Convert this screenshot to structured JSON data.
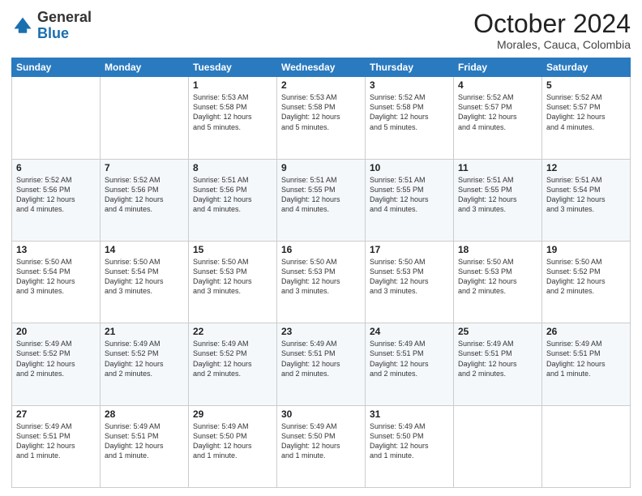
{
  "header": {
    "logo_general": "General",
    "logo_blue": "Blue",
    "month": "October 2024",
    "location": "Morales, Cauca, Colombia"
  },
  "days_of_week": [
    "Sunday",
    "Monday",
    "Tuesday",
    "Wednesday",
    "Thursday",
    "Friday",
    "Saturday"
  ],
  "weeks": [
    [
      {
        "day": "",
        "info": ""
      },
      {
        "day": "",
        "info": ""
      },
      {
        "day": "1",
        "info": "Sunrise: 5:53 AM\nSunset: 5:58 PM\nDaylight: 12 hours\nand 5 minutes."
      },
      {
        "day": "2",
        "info": "Sunrise: 5:53 AM\nSunset: 5:58 PM\nDaylight: 12 hours\nand 5 minutes."
      },
      {
        "day": "3",
        "info": "Sunrise: 5:52 AM\nSunset: 5:58 PM\nDaylight: 12 hours\nand 5 minutes."
      },
      {
        "day": "4",
        "info": "Sunrise: 5:52 AM\nSunset: 5:57 PM\nDaylight: 12 hours\nand 4 minutes."
      },
      {
        "day": "5",
        "info": "Sunrise: 5:52 AM\nSunset: 5:57 PM\nDaylight: 12 hours\nand 4 minutes."
      }
    ],
    [
      {
        "day": "6",
        "info": "Sunrise: 5:52 AM\nSunset: 5:56 PM\nDaylight: 12 hours\nand 4 minutes."
      },
      {
        "day": "7",
        "info": "Sunrise: 5:52 AM\nSunset: 5:56 PM\nDaylight: 12 hours\nand 4 minutes."
      },
      {
        "day": "8",
        "info": "Sunrise: 5:51 AM\nSunset: 5:56 PM\nDaylight: 12 hours\nand 4 minutes."
      },
      {
        "day": "9",
        "info": "Sunrise: 5:51 AM\nSunset: 5:55 PM\nDaylight: 12 hours\nand 4 minutes."
      },
      {
        "day": "10",
        "info": "Sunrise: 5:51 AM\nSunset: 5:55 PM\nDaylight: 12 hours\nand 4 minutes."
      },
      {
        "day": "11",
        "info": "Sunrise: 5:51 AM\nSunset: 5:55 PM\nDaylight: 12 hours\nand 3 minutes."
      },
      {
        "day": "12",
        "info": "Sunrise: 5:51 AM\nSunset: 5:54 PM\nDaylight: 12 hours\nand 3 minutes."
      }
    ],
    [
      {
        "day": "13",
        "info": "Sunrise: 5:50 AM\nSunset: 5:54 PM\nDaylight: 12 hours\nand 3 minutes."
      },
      {
        "day": "14",
        "info": "Sunrise: 5:50 AM\nSunset: 5:54 PM\nDaylight: 12 hours\nand 3 minutes."
      },
      {
        "day": "15",
        "info": "Sunrise: 5:50 AM\nSunset: 5:53 PM\nDaylight: 12 hours\nand 3 minutes."
      },
      {
        "day": "16",
        "info": "Sunrise: 5:50 AM\nSunset: 5:53 PM\nDaylight: 12 hours\nand 3 minutes."
      },
      {
        "day": "17",
        "info": "Sunrise: 5:50 AM\nSunset: 5:53 PM\nDaylight: 12 hours\nand 3 minutes."
      },
      {
        "day": "18",
        "info": "Sunrise: 5:50 AM\nSunset: 5:53 PM\nDaylight: 12 hours\nand 2 minutes."
      },
      {
        "day": "19",
        "info": "Sunrise: 5:50 AM\nSunset: 5:52 PM\nDaylight: 12 hours\nand 2 minutes."
      }
    ],
    [
      {
        "day": "20",
        "info": "Sunrise: 5:49 AM\nSunset: 5:52 PM\nDaylight: 12 hours\nand 2 minutes."
      },
      {
        "day": "21",
        "info": "Sunrise: 5:49 AM\nSunset: 5:52 PM\nDaylight: 12 hours\nand 2 minutes."
      },
      {
        "day": "22",
        "info": "Sunrise: 5:49 AM\nSunset: 5:52 PM\nDaylight: 12 hours\nand 2 minutes."
      },
      {
        "day": "23",
        "info": "Sunrise: 5:49 AM\nSunset: 5:51 PM\nDaylight: 12 hours\nand 2 minutes."
      },
      {
        "day": "24",
        "info": "Sunrise: 5:49 AM\nSunset: 5:51 PM\nDaylight: 12 hours\nand 2 minutes."
      },
      {
        "day": "25",
        "info": "Sunrise: 5:49 AM\nSunset: 5:51 PM\nDaylight: 12 hours\nand 2 minutes."
      },
      {
        "day": "26",
        "info": "Sunrise: 5:49 AM\nSunset: 5:51 PM\nDaylight: 12 hours\nand 1 minute."
      }
    ],
    [
      {
        "day": "27",
        "info": "Sunrise: 5:49 AM\nSunset: 5:51 PM\nDaylight: 12 hours\nand 1 minute."
      },
      {
        "day": "28",
        "info": "Sunrise: 5:49 AM\nSunset: 5:51 PM\nDaylight: 12 hours\nand 1 minute."
      },
      {
        "day": "29",
        "info": "Sunrise: 5:49 AM\nSunset: 5:50 PM\nDaylight: 12 hours\nand 1 minute."
      },
      {
        "day": "30",
        "info": "Sunrise: 5:49 AM\nSunset: 5:50 PM\nDaylight: 12 hours\nand 1 minute."
      },
      {
        "day": "31",
        "info": "Sunrise: 5:49 AM\nSunset: 5:50 PM\nDaylight: 12 hours\nand 1 minute."
      },
      {
        "day": "",
        "info": ""
      },
      {
        "day": "",
        "info": ""
      }
    ]
  ]
}
